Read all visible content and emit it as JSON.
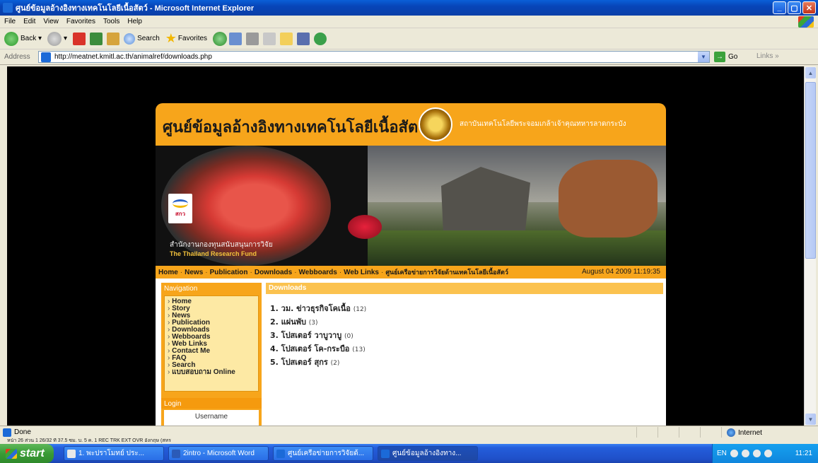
{
  "window": {
    "title": "ศูนย์ข้อมูลอ้างอิงทางเทคโนโลยีเนื้อสัตว์ - Microsoft Internet Explorer",
    "controls": [
      "minimize",
      "maximize",
      "close"
    ]
  },
  "menu": [
    "File",
    "Edit",
    "View",
    "Favorites",
    "Tools",
    "Help"
  ],
  "toolbar": {
    "back": "Back",
    "search": "Search",
    "favorites": "Favorites"
  },
  "address": {
    "label": "Address",
    "url": "http://meatnet.kmitl.ac.th/animalref/downloads.php",
    "go": "Go",
    "links": "Links"
  },
  "site": {
    "title": "ศูนย์ข้อมูลอ้างอิงทางเทคโนโลยีเนื้อสัตว์",
    "subtitle": "สถาบันเทคโนโลยีพระจอมเกล้าเจ้าคุณทหารลาดกระบัง",
    "trf_th": "สำนักงานกองทุนสนับสนุนการวิจัย",
    "trf_en": "The Thailand Research Fund",
    "trf_logo_text": "สกว"
  },
  "nav": {
    "items": [
      "Home",
      "News",
      "Publication",
      "Downloads",
      "Webboards",
      "Web Links",
      "ศูนย์เครือข่ายการวิจัยด้านเทคโนโลยีเนื้อสัตว์"
    ],
    "separator": "·",
    "date": "August 04 2009 11:19:35"
  },
  "sidebar": {
    "heading": "Navigation",
    "items": [
      "Home",
      "Story",
      "News",
      "Publication",
      "Downloads",
      "Webboards",
      "Web Links",
      "Contact Me",
      "FAQ",
      "Search",
      "แบบสอบถาม Online"
    ],
    "login_heading": "Login",
    "username_label": "Username"
  },
  "downloads": {
    "heading": "Downloads",
    "items": [
      {
        "label": "1. วม. ข่าวธุรกิจโคเนื้อ",
        "count": "(12)"
      },
      {
        "label": "2. แผ่นพับ",
        "count": "(3)"
      },
      {
        "label": "3. โปสเตอร์ วาบูวาบู",
        "count": "(0)"
      },
      {
        "label": "4. โปสเตอร์ โค-กระบือ",
        "count": "(13)"
      },
      {
        "label": "5. โปสเตอร์ สุกร",
        "count": "(2)"
      }
    ]
  },
  "status": {
    "text": "Done",
    "zone": "Internet"
  },
  "word_status": "หน้า 26    ส่วน 1    26/32    ที่ 37.5 ซม.  บ. 5   ค. 1     REC  TRK  EXT  OVR    อังกฤษ (สหร  ",
  "taskbar": {
    "start": "start",
    "tasks": [
      "1. พะปราโมทย์ ประ...",
      "2intro - Microsoft Word",
      "ศูนย์เครือข่ายการวิจัยด้...",
      "ศูนย์ข้อมูลอ้างอิงทาง..."
    ],
    "lang": "EN",
    "clock": "11:21"
  },
  "colors": {
    "orange": "#f7a51b",
    "xp_blue": "#245edb",
    "start_green": "#3a9b36"
  }
}
